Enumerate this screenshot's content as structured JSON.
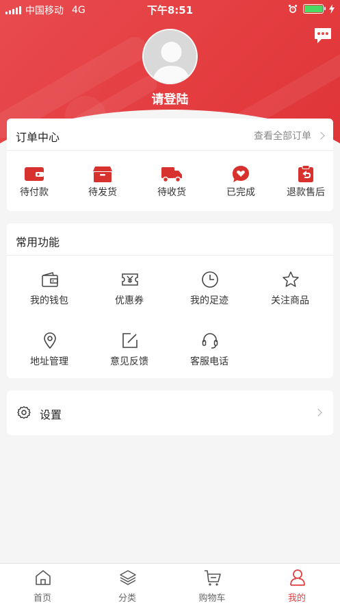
{
  "status_bar": {
    "carrier": "中国移动",
    "network": "4G",
    "time": "下午8:51"
  },
  "header": {
    "login_text": "请登陆",
    "message_icon": "chat-bubble-icon",
    "avatar_icon": "default-avatar"
  },
  "order_center": {
    "title": "订单中心",
    "view_all": "查看全部订单",
    "items": [
      {
        "label": "待付款",
        "icon": "wallet-icon"
      },
      {
        "label": "待发货",
        "icon": "box-icon"
      },
      {
        "label": "待收货",
        "icon": "truck-icon"
      },
      {
        "label": "已完成",
        "icon": "heart-icon"
      },
      {
        "label": "退款售后",
        "icon": "refund-icon"
      }
    ]
  },
  "common_functions": {
    "title": "常用功能",
    "items": [
      {
        "label": "我的钱包",
        "icon": "wallet-icon"
      },
      {
        "label": "优惠券",
        "icon": "coupon-icon"
      },
      {
        "label": "我的足迹",
        "icon": "clock-icon"
      },
      {
        "label": "关注商品",
        "icon": "star-icon"
      },
      {
        "label": "地址管理",
        "icon": "location-icon"
      },
      {
        "label": "意见反馈",
        "icon": "edit-icon"
      },
      {
        "label": "客服电话",
        "icon": "headset-icon"
      }
    ]
  },
  "settings": {
    "label": "设置",
    "icon": "gear-icon"
  },
  "tab_bar": {
    "items": [
      {
        "label": "首页",
        "icon": "home-icon"
      },
      {
        "label": "分类",
        "icon": "layers-icon"
      },
      {
        "label": "购物车",
        "icon": "cart-icon"
      },
      {
        "label": "我的",
        "icon": "user-icon"
      }
    ],
    "active_index": 3
  },
  "colors": {
    "brand_red": "#e43d40",
    "battery_green": "#4cd964"
  }
}
